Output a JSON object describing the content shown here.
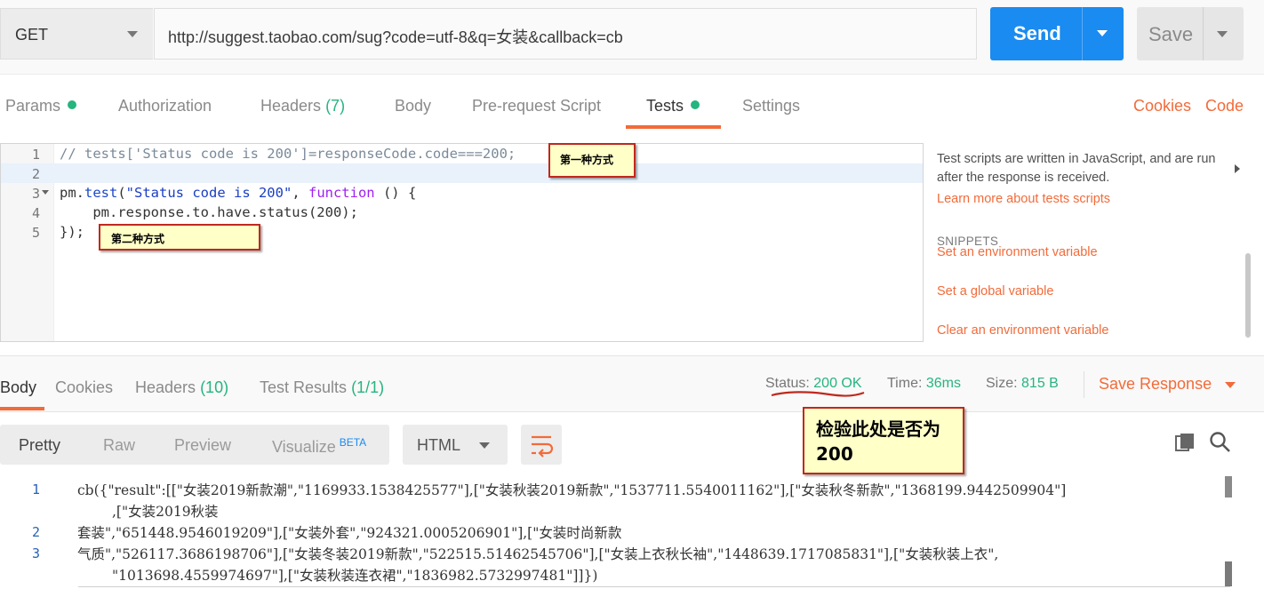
{
  "request": {
    "method": "GET",
    "url": "http://suggest.taobao.com/sug?code=utf-8&q=女装&callback=cb",
    "send_label": "Send",
    "save_label": "Save"
  },
  "request_tabs": [
    {
      "label": "Params",
      "dot": true
    },
    {
      "label": "Authorization"
    },
    {
      "label": "Headers",
      "count": "(7)"
    },
    {
      "label": "Body"
    },
    {
      "label": "Pre-request Script"
    },
    {
      "label": "Tests",
      "dot": true,
      "active": true
    },
    {
      "label": "Settings"
    }
  ],
  "links": {
    "cookies": "Cookies",
    "code": "Code"
  },
  "editor": {
    "line_numbers": [
      "1",
      "2",
      "3",
      "4",
      "5"
    ],
    "lines": [
      {
        "parts": [
          "// tests['Status code is 200']=responseCode.code===200;"
        ]
      },
      {
        "parts": [
          ""
        ]
      },
      {
        "parts": [
          "pm.",
          "test",
          "(",
          "\"Status code is 200\"",
          ", ",
          "function",
          " () {"
        ]
      },
      {
        "parts": [
          "    pm.response.to.have.status(200);"
        ]
      },
      {
        "parts": [
          "});"
        ]
      }
    ],
    "callout_1": "第一种方式",
    "callout_2": "第二种方式"
  },
  "side_panel": {
    "description": "Test scripts are written in JavaScript, and are run after the response is received.",
    "learn_more": "Learn more about tests scripts",
    "snippets_heading": "SNIPPETS",
    "snippets": [
      "Set an environment variable",
      "Set a global variable",
      "Clear an environment variable"
    ]
  },
  "response_tabs": [
    {
      "label": "Body",
      "active": true
    },
    {
      "label": "Cookies"
    },
    {
      "label": "Headers",
      "count": "(10)"
    },
    {
      "label": "Test Results",
      "count": "(1/1)"
    }
  ],
  "response_meta": {
    "status_label": "Status:",
    "status_value": "200 OK",
    "time_label": "Time:",
    "time_value": "36ms",
    "size_label": "Size:",
    "size_value": "815 B",
    "save_response": "Save Response",
    "note": "检验此处是否为200"
  },
  "view_modes": [
    {
      "label": "Pretty",
      "active": true
    },
    {
      "label": "Raw"
    },
    {
      "label": "Preview"
    },
    {
      "label": "Visualize",
      "badge": "BETA"
    }
  ],
  "format": "HTML",
  "response_body": {
    "line_numbers": [
      "1",
      "2",
      "3"
    ],
    "rows": [
      "cb({\"result\":[[\"女装2019新款潮\",\"1169933.1538425577\"],[\"女装秋装2019新款\",\"1537711.5540011162\"],[\"女装秋冬新款\",\"1368199.9442509904\"]",
      ",[\"女装2019秋装",
      "套装\",\"651448.9546019209\"],[\"女装外套\",\"924321.0005206901\"],[\"女装时尚新款",
      "气质\",\"526117.3686198706\"],[\"女装冬装2019新款\",\"522515.51462545706\"],[\"女装上衣秋长袖\",\"1448639.1717085831\"],[\"女装秋装上衣\",",
      "\"1013698.4559974697\"],[\"女装秋装连衣裙\",\"1836982.5732997481\"]]})"
    ]
  },
  "colors": {
    "accent_orange": "#f26b3a",
    "send_blue": "#1a8bf0",
    "status_green": "#26b47f",
    "callout_fill": "#ffffc8",
    "callout_border": "#c0281e"
  }
}
